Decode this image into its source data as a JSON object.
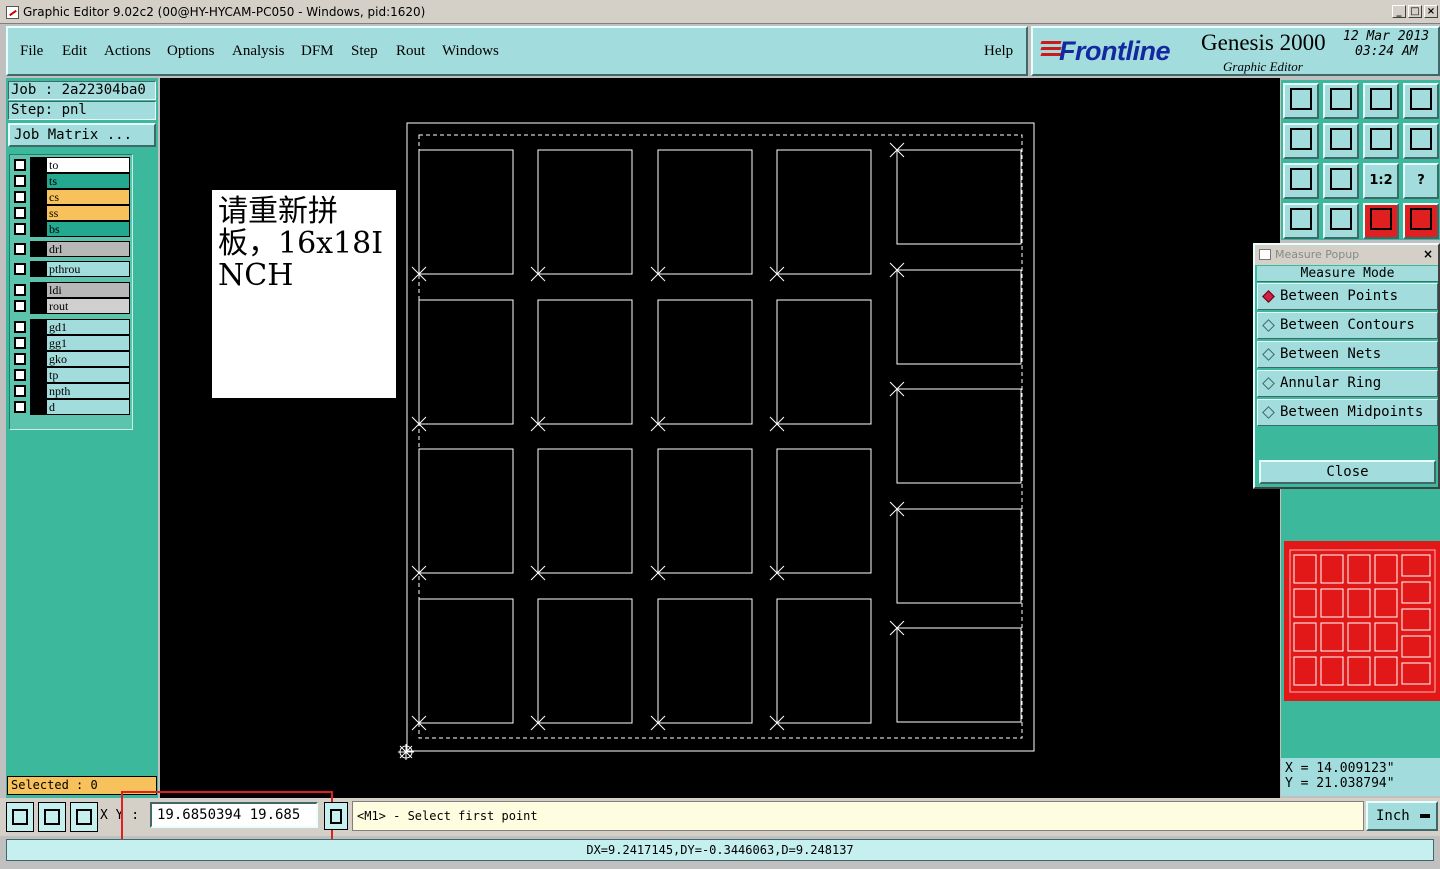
{
  "window": {
    "title": "Graphic Editor 9.02c2 (00@HY-HYCAM-PC050 - Windows, pid:1620)",
    "controls": [
      "_",
      "□",
      "×"
    ]
  },
  "menu": {
    "items": [
      "File",
      "Edit",
      "Actions",
      "Options",
      "Analysis",
      "DFM",
      "Step",
      "Rout",
      "Windows"
    ],
    "help": "Help"
  },
  "header": {
    "logo": "Frontline",
    "product": "Genesis 2000",
    "subtitle": "Graphic Editor",
    "date": "12 Mar 2013",
    "time": "03:24 AM",
    "brand_color": "#1428a0",
    "logo_accent": "#d01818"
  },
  "left": {
    "job": "Job : 2a22304ba0",
    "step": "Step: pnl",
    "job_matrix": "Job Matrix ...",
    "layers": [
      {
        "name": "to",
        "color": "#ffffff"
      },
      {
        "name": "ts",
        "color": "#24a890"
      },
      {
        "name": "cs",
        "color": "#f7c25c"
      },
      {
        "name": "ss",
        "color": "#f7c25c"
      },
      {
        "name": "bs",
        "color": "#24a890"
      },
      {
        "name": "drl",
        "color": "#b8b8b8"
      },
      {
        "name": "pthrou",
        "color": "#a3dcdc"
      },
      {
        "name": "ldi",
        "color": "#b8b8b8"
      },
      {
        "name": "rout",
        "color": "#d0d0d0"
      },
      {
        "name": "gd1",
        "color": "#a3dcdc"
      },
      {
        "name": "gg1",
        "color": "#a3dcdc"
      },
      {
        "name": "gko",
        "color": "#a3dcdc"
      },
      {
        "name": "tp",
        "color": "#a3dcdc"
      },
      {
        "name": "npth",
        "color": "#a3dcdc"
      },
      {
        "name": "d",
        "color": "#a3dcdc"
      }
    ],
    "selected": "Selected : 0"
  },
  "canvas": {
    "note": "请重新拼板，16x18INCH"
  },
  "toolbar": {
    "icons": [
      "export-icon",
      "import-icon",
      "home-icon",
      "panel-icon",
      "pan-left-icon",
      "pan-right-icon",
      "undo-zoom-icon",
      "snap-icon",
      "zoom-fit-icon",
      "zoom-center-icon",
      "zoom-1to2-icon",
      "help-icon",
      "settings-icon",
      "grid-icon",
      "net-icon",
      "net-compare-icon"
    ],
    "labels": {
      "one_two": "1:2",
      "help": "?"
    }
  },
  "popup": {
    "title": "Measure Popup",
    "mode_label": "Measure Mode",
    "options": [
      "Between Points",
      "Between Contours",
      "Between Nets",
      "Annular Ring",
      "Between Midpoints"
    ],
    "selected_index": 0,
    "close": "Close"
  },
  "coords": {
    "x": "X  =  14.009123\"",
    "y": "Y  =  21.038794\""
  },
  "bottom": {
    "xy_label": "X Y :",
    "xy_value": "19.6850394 19.685",
    "prompt": "<M1> - Select first point",
    "unit": "Inch",
    "status": "DX=9.2417145,DY=-0.3446063,D=9.248137"
  }
}
